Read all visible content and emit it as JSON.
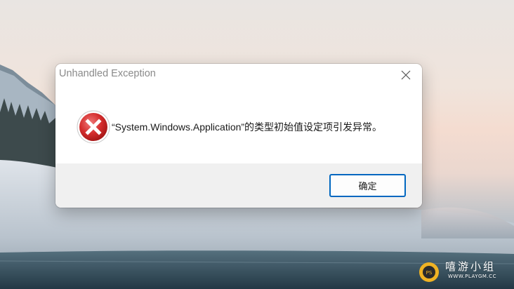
{
  "dialog": {
    "title": "Unhandled Exception",
    "message": "“System.Windows.Application”的类型初始值设定项引发异常。",
    "ok_label": "确定",
    "icon": "error-icon"
  },
  "watermark": {
    "text": "嘻游小组",
    "sub": "WWW.PLAYGM.CC"
  },
  "colors": {
    "accent": "#0067c0",
    "error_red": "#d42d2d",
    "footer_bg": "#f0f0f0"
  }
}
